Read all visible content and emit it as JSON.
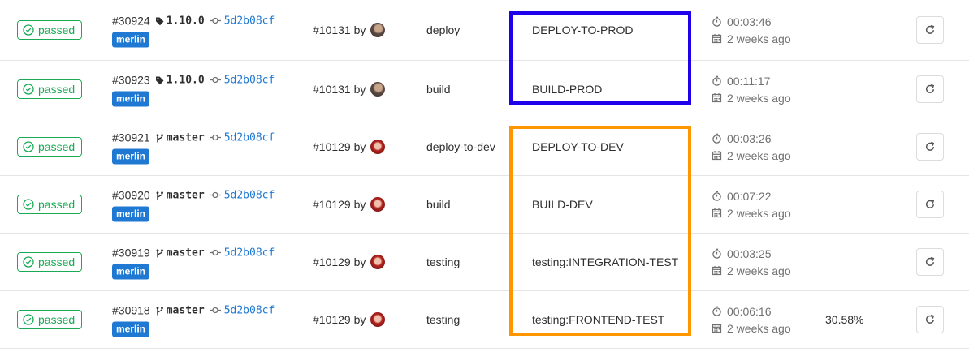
{
  "colors": {
    "passed": "#1aaa55",
    "link": "#1f78d1",
    "highlight_prod": "#1f00ea",
    "highlight_dev": "#ff9600"
  },
  "icons": {
    "status": "check-circle-icon",
    "tag": "tag-icon",
    "branch": "branch-icon",
    "commit": "commit-icon",
    "duration": "timer-icon",
    "date": "calendar-icon",
    "retry": "retry-icon"
  },
  "jobs": [
    {
      "status": "passed",
      "job_id": "#30924",
      "ref_type": "tag",
      "ref": "1.10.0",
      "sha": "5d2b08cf",
      "label": "merlin",
      "pipeline": "#10131 by",
      "stage": "deploy",
      "name": "DEPLOY-TO-PROD",
      "duration": "00:03:46",
      "finished": "2 weeks ago",
      "coverage": ""
    },
    {
      "status": "passed",
      "job_id": "#30923",
      "ref_type": "tag",
      "ref": "1.10.0",
      "sha": "5d2b08cf",
      "label": "merlin",
      "pipeline": "#10131 by",
      "stage": "build",
      "name": "BUILD-PROD",
      "duration": "00:11:17",
      "finished": "2 weeks ago",
      "coverage": ""
    },
    {
      "status": "passed",
      "job_id": "#30921",
      "ref_type": "branch",
      "ref": "master",
      "sha": "5d2b08cf",
      "label": "merlin",
      "pipeline": "#10129 by",
      "stage": "deploy-to-dev",
      "name": "DEPLOY-TO-DEV",
      "duration": "00:03:26",
      "finished": "2 weeks ago",
      "coverage": ""
    },
    {
      "status": "passed",
      "job_id": "#30920",
      "ref_type": "branch",
      "ref": "master",
      "sha": "5d2b08cf",
      "label": "merlin",
      "pipeline": "#10129 by",
      "stage": "build",
      "name": "BUILD-DEV",
      "duration": "00:07:22",
      "finished": "2 weeks ago",
      "coverage": ""
    },
    {
      "status": "passed",
      "job_id": "#30919",
      "ref_type": "branch",
      "ref": "master",
      "sha": "5d2b08cf",
      "label": "merlin",
      "pipeline": "#10129 by",
      "stage": "testing",
      "name": "testing:INTEGRATION-TEST",
      "duration": "00:03:25",
      "finished": "2 weeks ago",
      "coverage": ""
    },
    {
      "status": "passed",
      "job_id": "#30918",
      "ref_type": "branch",
      "ref": "master",
      "sha": "5d2b08cf",
      "label": "merlin",
      "pipeline": "#10129 by",
      "stage": "testing",
      "name": "testing:FRONTEND-TEST",
      "duration": "00:06:16",
      "finished": "2 weeks ago",
      "coverage": "30.58%"
    }
  ]
}
